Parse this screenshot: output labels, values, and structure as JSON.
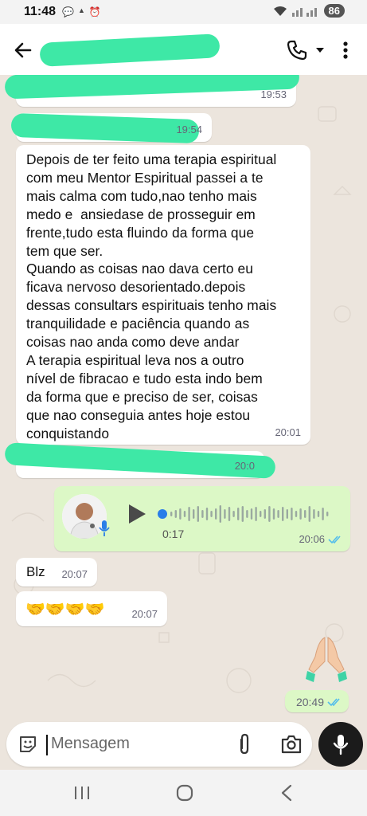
{
  "status_bar": {
    "time": "11:48",
    "battery": "86"
  },
  "header": {
    "contact_name": ""
  },
  "messages": [
    {
      "id": "m1",
      "direction": "in",
      "time": "19:53",
      "redacted": true
    },
    {
      "id": "m2",
      "direction": "in",
      "time": "19:54",
      "redacted": true
    },
    {
      "id": "m3",
      "direction": "in",
      "text": "Depois de ter feito uma terapia espiritual\ncom meu Mentor Espiritual passei a te\nmais calma com tudo,nao tenho mais\nmedo e  ansiedase de prosseguir em\nfrente,tudo esta fluindo da forma que\ntem que ser.\nQuando as coisas nao dava certo eu\nficava nervoso desorientado.depois\ndessas consultars espirituais tenho mais\ntranquilidade e paciência quando as\ncoisas nao anda como deve andar\nA terapia espiritual leva nos a outro\nnível de fibracao e tudo esta indo bem\nda forma que e preciso de ser, coisas\nque nao conseguia antes hoje estou\nconquistando",
      "time": "20:01"
    },
    {
      "id": "m4",
      "direction": "in",
      "time": "20:0",
      "redacted": true
    },
    {
      "id": "m5",
      "direction": "out",
      "type": "voice",
      "duration": "0:17",
      "time": "20:06",
      "progress": 0.0
    },
    {
      "id": "m6",
      "direction": "in",
      "text": "Blz",
      "time": "20:07"
    },
    {
      "id": "m7",
      "direction": "in",
      "text": "🤝🤝🤝🤝",
      "time": "20:07"
    },
    {
      "id": "m8",
      "direction": "out",
      "sticker": "🙏🏼",
      "time": "20:49"
    }
  ],
  "composer": {
    "placeholder": "Mensagem"
  },
  "colors": {
    "redaction": "#3ee8a6",
    "outgoing_bubble": "#dcf8c6",
    "read_ticks": "#53bdeb"
  }
}
